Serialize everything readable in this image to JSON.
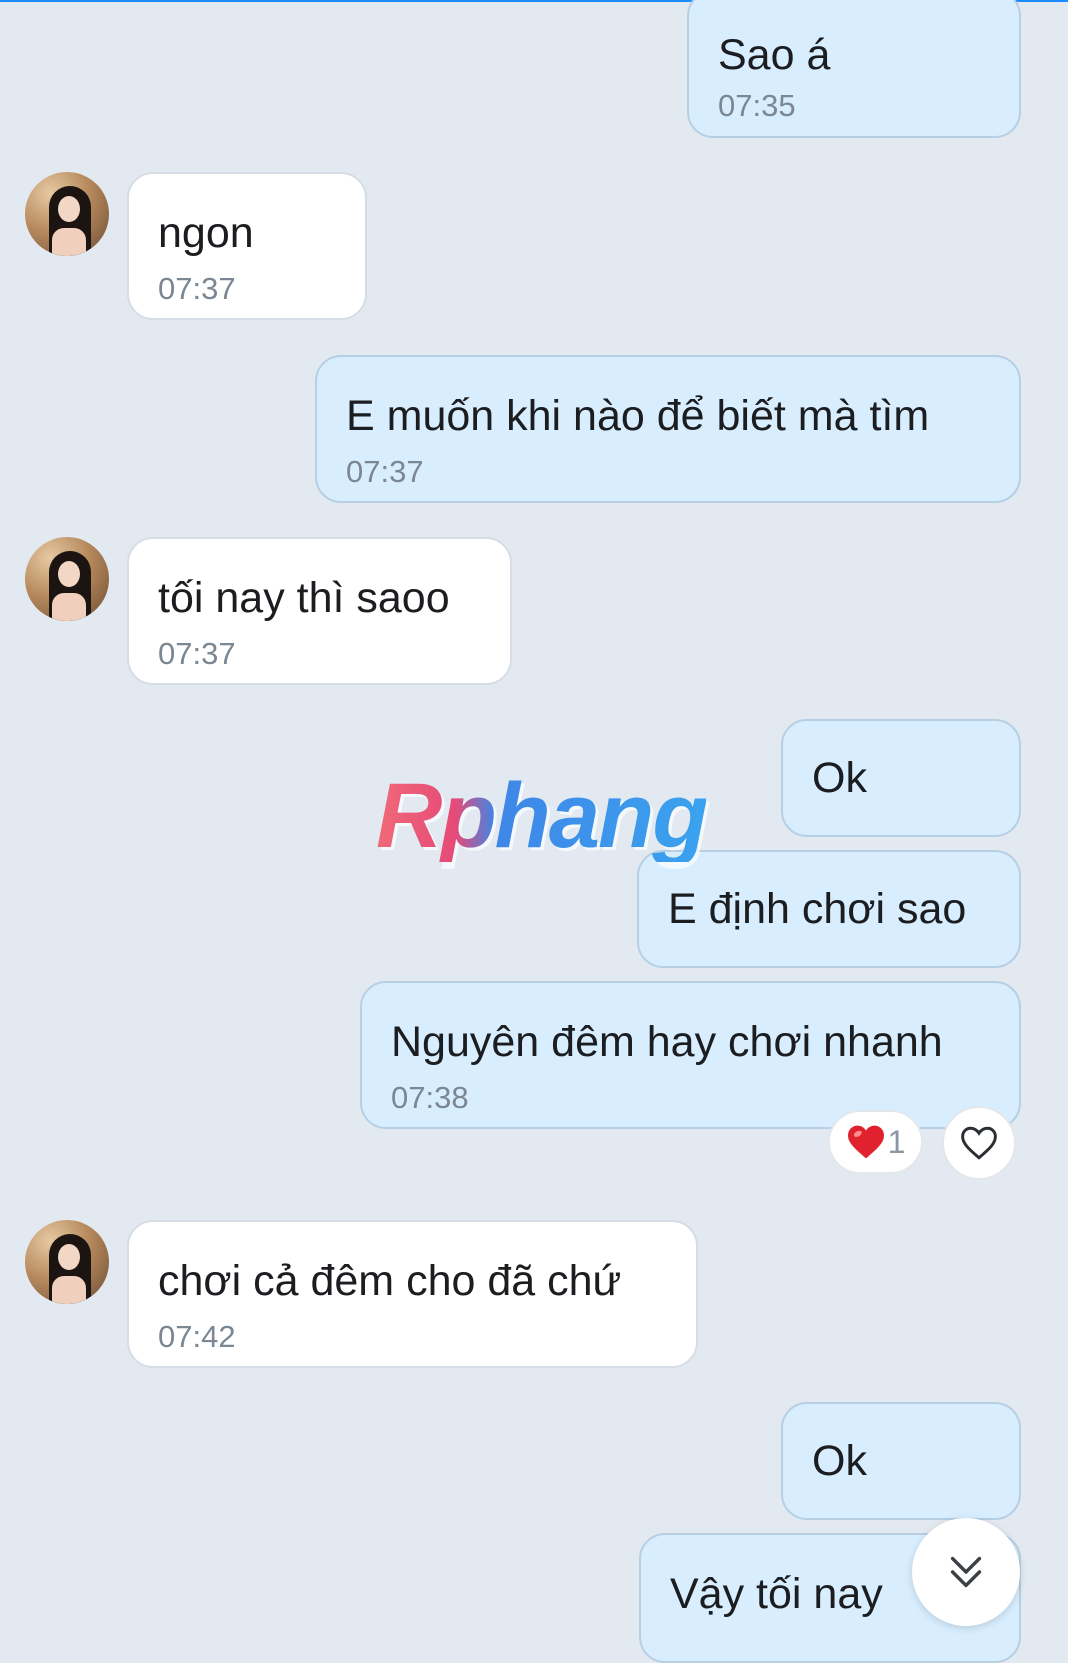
{
  "watermark": "Rphang",
  "messages": [
    {
      "side": "me",
      "text": "Sao á",
      "time": "07:35"
    },
    {
      "side": "them",
      "text": "ngon",
      "time": "07:37"
    },
    {
      "side": "me",
      "text": "E muốn khi nào để biết mà tìm",
      "time": "07:37"
    },
    {
      "side": "them",
      "text": "tối nay thì saoo",
      "time": "07:37"
    },
    {
      "side": "me",
      "text": "Ok"
    },
    {
      "side": "me",
      "text": "E định chơi sao"
    },
    {
      "side": "me",
      "text": "Nguyên đêm hay chơi nhanh",
      "time": "07:38",
      "reaction": {
        "icon": "red-heart",
        "count": "1"
      }
    },
    {
      "side": "them",
      "text": "chơi cả đêm cho đã chứ",
      "time": "07:42"
    },
    {
      "side": "me",
      "text": "Ok"
    },
    {
      "side": "me",
      "text": "Vậy tối nay"
    }
  ],
  "colors": {
    "background": "#e2e9f1",
    "outgoing_bubble": "#d8eefe",
    "incoming_bubble": "#ffffff",
    "heart": "#e0222f"
  },
  "icons": {
    "reaction_add": "heart-outline-icon",
    "scroll_down": "double-chevron-down-icon"
  }
}
